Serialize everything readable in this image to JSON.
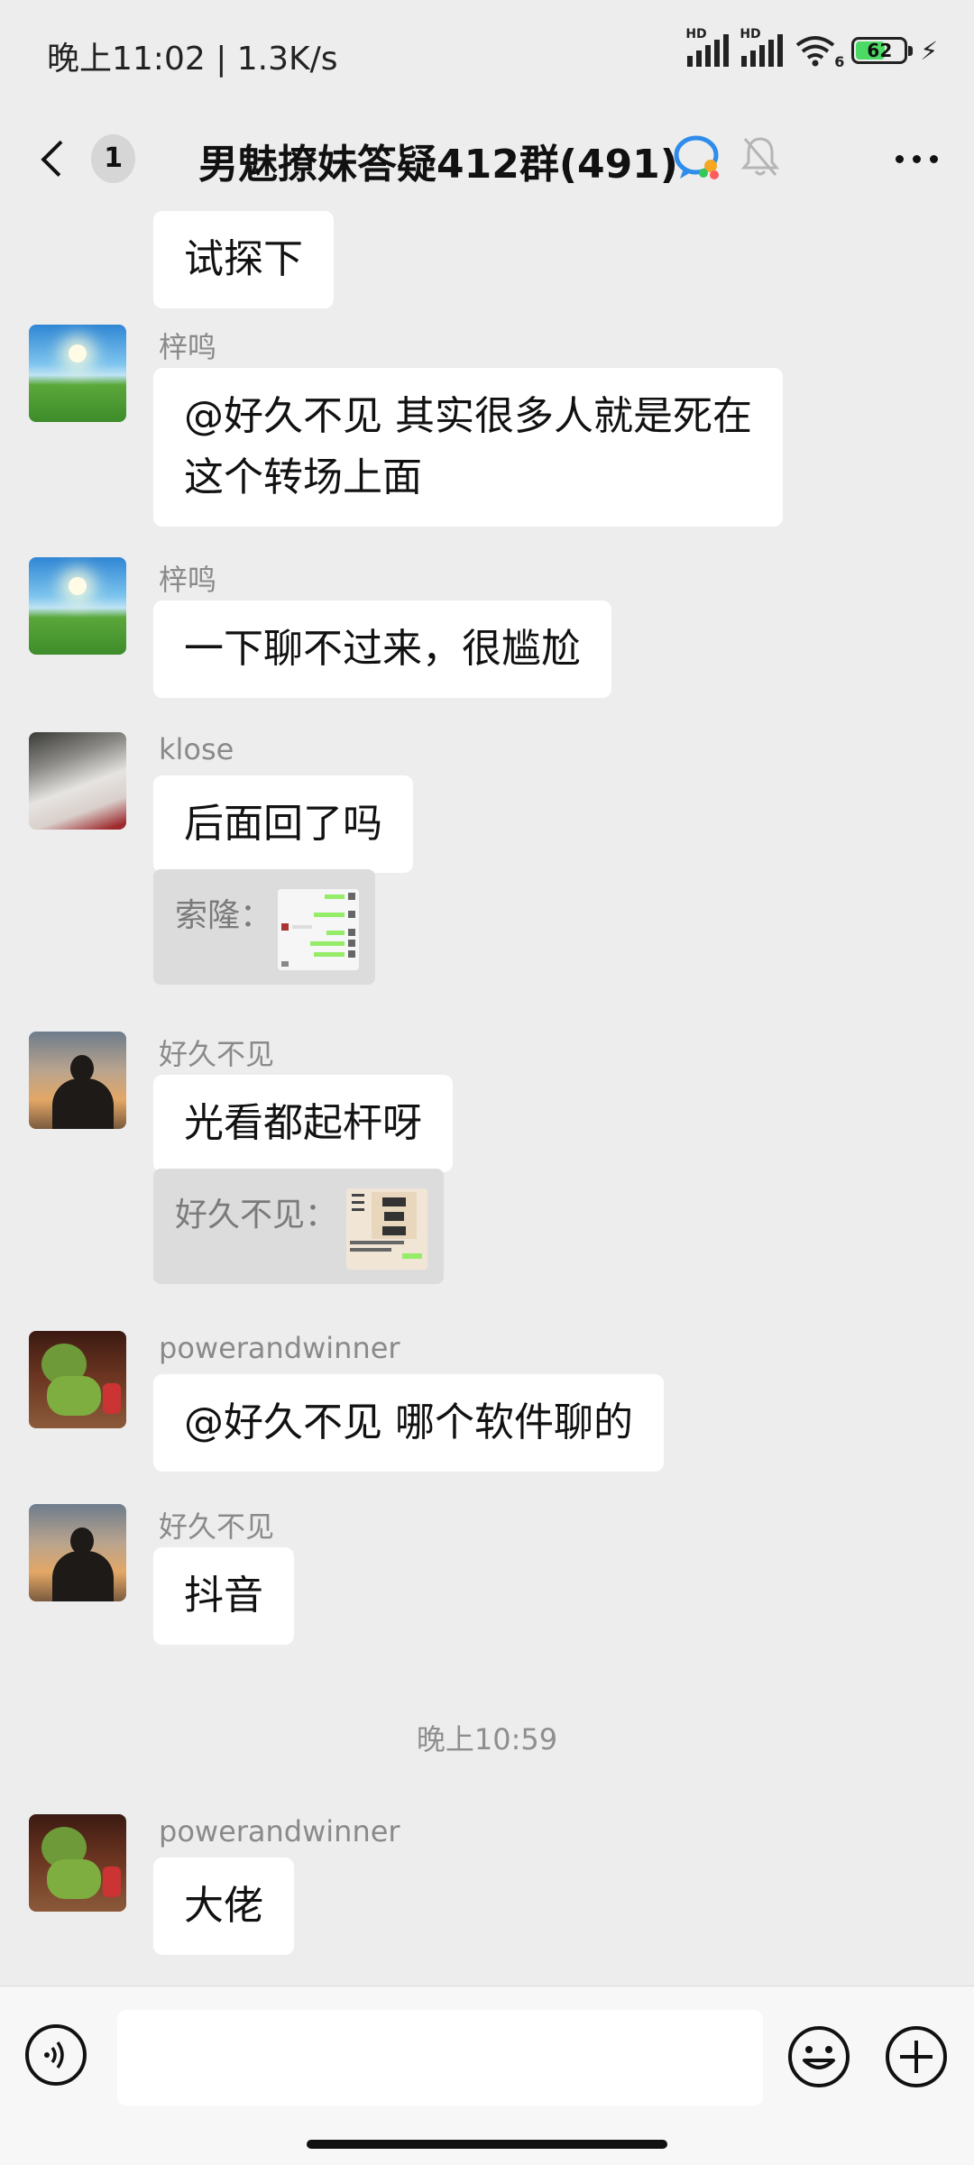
{
  "status_bar": {
    "time": "晚上11:02 | 1.3K/s",
    "signal1_label": "HD",
    "signal2_label": "HD",
    "wifi_label": "6",
    "battery": "62",
    "battery_level": 0.62
  },
  "header": {
    "back_badge": "1",
    "title": "男魅撩妹答疑412群(491)"
  },
  "messages": [
    {
      "text": "试探下"
    },
    {
      "sender": "梓鸣",
      "lines": [
        "@好久不见  其实很多人就是死在",
        "这个转场上面"
      ]
    },
    {
      "sender": "梓鸣",
      "text": "一下聊不过来，很尴尬"
    },
    {
      "sender": "klose",
      "text": "后面回了吗",
      "quote": "索隆："
    },
    {
      "sender": "好久不见",
      "text": "光看都起杆呀",
      "quote": "好久不见："
    },
    {
      "sender": "powerandwinner",
      "text": "@好久不见  哪个软件聊的"
    },
    {
      "sender": "好久不见",
      "text": "抖音"
    },
    {
      "time_separator": "晚上10:59"
    },
    {
      "sender": "powerandwinner",
      "text": "大佬"
    }
  ],
  "icons": {
    "back": "chevron-left-icon",
    "group": "chat-bubble-icon",
    "mute": "bell-off-icon",
    "more": "more-icon",
    "voice": "voice-icon",
    "emoji": "emoji-icon",
    "plus": "plus-icon"
  },
  "colors": {
    "background": "#EDEDED",
    "bubble": "#FFFFFF",
    "quote": "#DCDCDC",
    "battery": "#4CD964"
  }
}
